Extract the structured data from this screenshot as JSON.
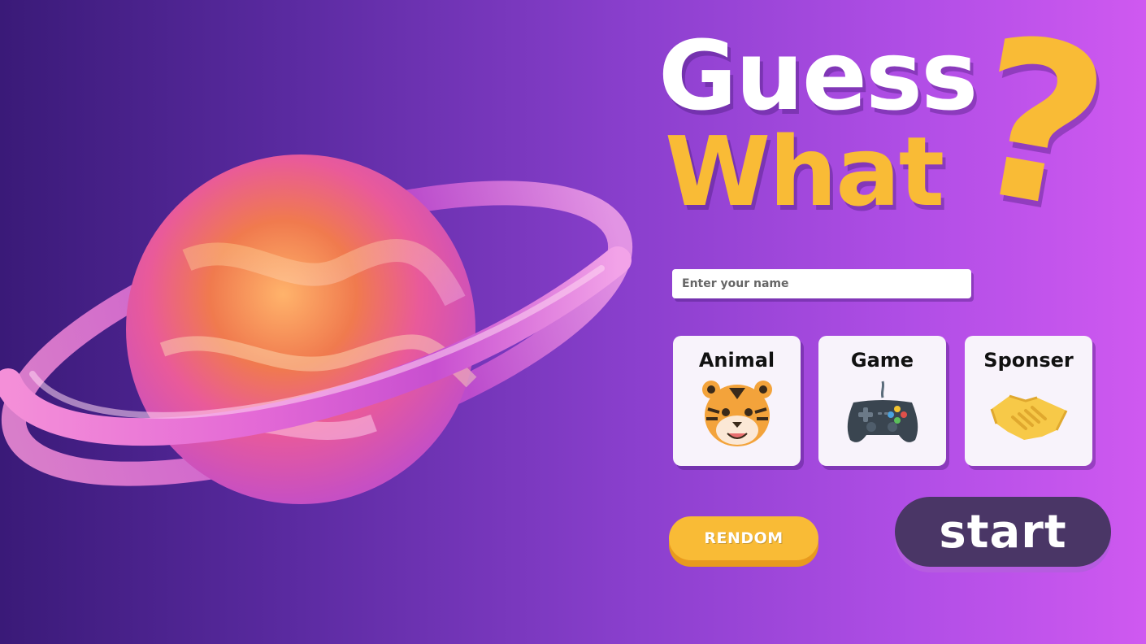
{
  "header": {
    "title_line1": "Guess",
    "title_line2": "What",
    "title_mark": "?"
  },
  "form": {
    "name_placeholder": "Enter your name"
  },
  "categories": [
    {
      "label": "Animal",
      "icon": "tiger-face-icon"
    },
    {
      "label": "Game",
      "icon": "game-controller-icon"
    },
    {
      "label": "Sponser",
      "icon": "handshake-icon"
    }
  ],
  "buttons": {
    "random_label": "RENDOM",
    "start_label": "start"
  },
  "colors": {
    "accent_yellow": "#f9bb36",
    "start_button": "#4a3666",
    "card_background": "#f8f3fb"
  }
}
